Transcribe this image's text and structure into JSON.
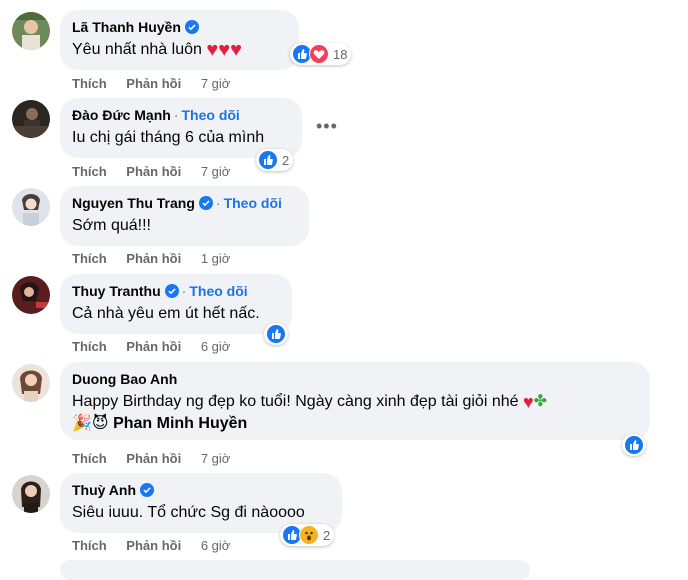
{
  "actions": {
    "like": "Thích",
    "reply": "Phản hồi"
  },
  "follow_label": "Theo dõi",
  "comments": [
    {
      "name": "Lã Thanh Huyền",
      "verified": true,
      "text": "Yêu nhất nhà luôn",
      "hearts": "♥♥♥",
      "time": "7 giờ",
      "reaction_count": "18"
    },
    {
      "name": "Đào Đức Mạnh",
      "text": "Iu chị gái tháng 6 của mình",
      "time": "7 giờ",
      "reaction_count": "2"
    },
    {
      "name": "Nguyen Thu Trang",
      "verified": true,
      "text": "Sớm quá!!!",
      "time": "1 giờ"
    },
    {
      "name": "Thuy Tranthu",
      "verified": true,
      "text": "Cả nhà yêu em út hết nấc.",
      "time": "6 giờ"
    },
    {
      "name": "Duong Bao Anh",
      "text": "Happy Birthday ng đẹp ko tuổi! Ngày càng xinh đẹp tài giỏi nhé",
      "text2_emoji": "🎉😈",
      "mention": "Phan Minh Huyền",
      "time": "7 giờ"
    },
    {
      "name": "Thuỳ Anh",
      "verified": true,
      "text": "Siêu iuuu. Tổ chức Sg đi nàoooo",
      "time": "6 giờ",
      "reaction_count": "2"
    }
  ],
  "colors": {
    "bubble": "#f0f2f5",
    "link": "#1b74e4",
    "like": "#1877f2",
    "love": "#f33e58",
    "meta": "#65676b"
  }
}
